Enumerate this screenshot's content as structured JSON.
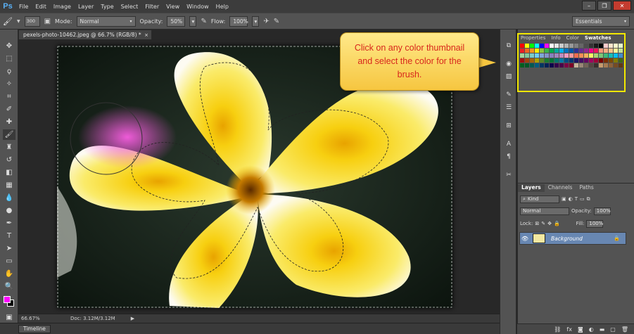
{
  "app": {
    "logo": "Ps",
    "menu": [
      "File",
      "Edit",
      "Image",
      "Layer",
      "Type",
      "Select",
      "Filter",
      "View",
      "Window",
      "Help"
    ],
    "window_controls": [
      "minimize-icon",
      "restore-icon",
      "close-icon"
    ]
  },
  "options": {
    "brush_size": "300",
    "mode_label": "Mode:",
    "mode_value": "Normal",
    "opacity_label": "Opacity:",
    "opacity_value": "50%",
    "flow_label": "Flow:",
    "flow_value": "100%",
    "workspace": "Essentials"
  },
  "document": {
    "tab_title": "pexels-photo-10462.jpeg @ 66.7% (RGB/8) *",
    "close": "×"
  },
  "status": {
    "zoom": "66.67%",
    "doc_size": "Doc: 3.12M/3.12M",
    "arrow": "▶"
  },
  "timeline": {
    "label": "Timeline"
  },
  "swatches_panel": {
    "tabs": [
      "Properties",
      "Info",
      "Color",
      "Swatches"
    ],
    "active_tab": "Swatches"
  },
  "layers_panel": {
    "tabs": [
      "Layers",
      "Channels",
      "Paths"
    ],
    "kind_label": "Kind",
    "blend_mode": "Normal",
    "opacity_label": "Opacity:",
    "opacity_value": "100%",
    "lock_label": "Lock:",
    "fill_label": "Fill:",
    "fill_value": "100%",
    "layer_name": "Background"
  },
  "callout": {
    "text": "Click on any color thumbnail and select the color for the brush."
  },
  "colors": {
    "foreground": "#ff00ff",
    "background": "#000000",
    "highlight": "#f2e800",
    "callout_text": "#d8261c"
  }
}
